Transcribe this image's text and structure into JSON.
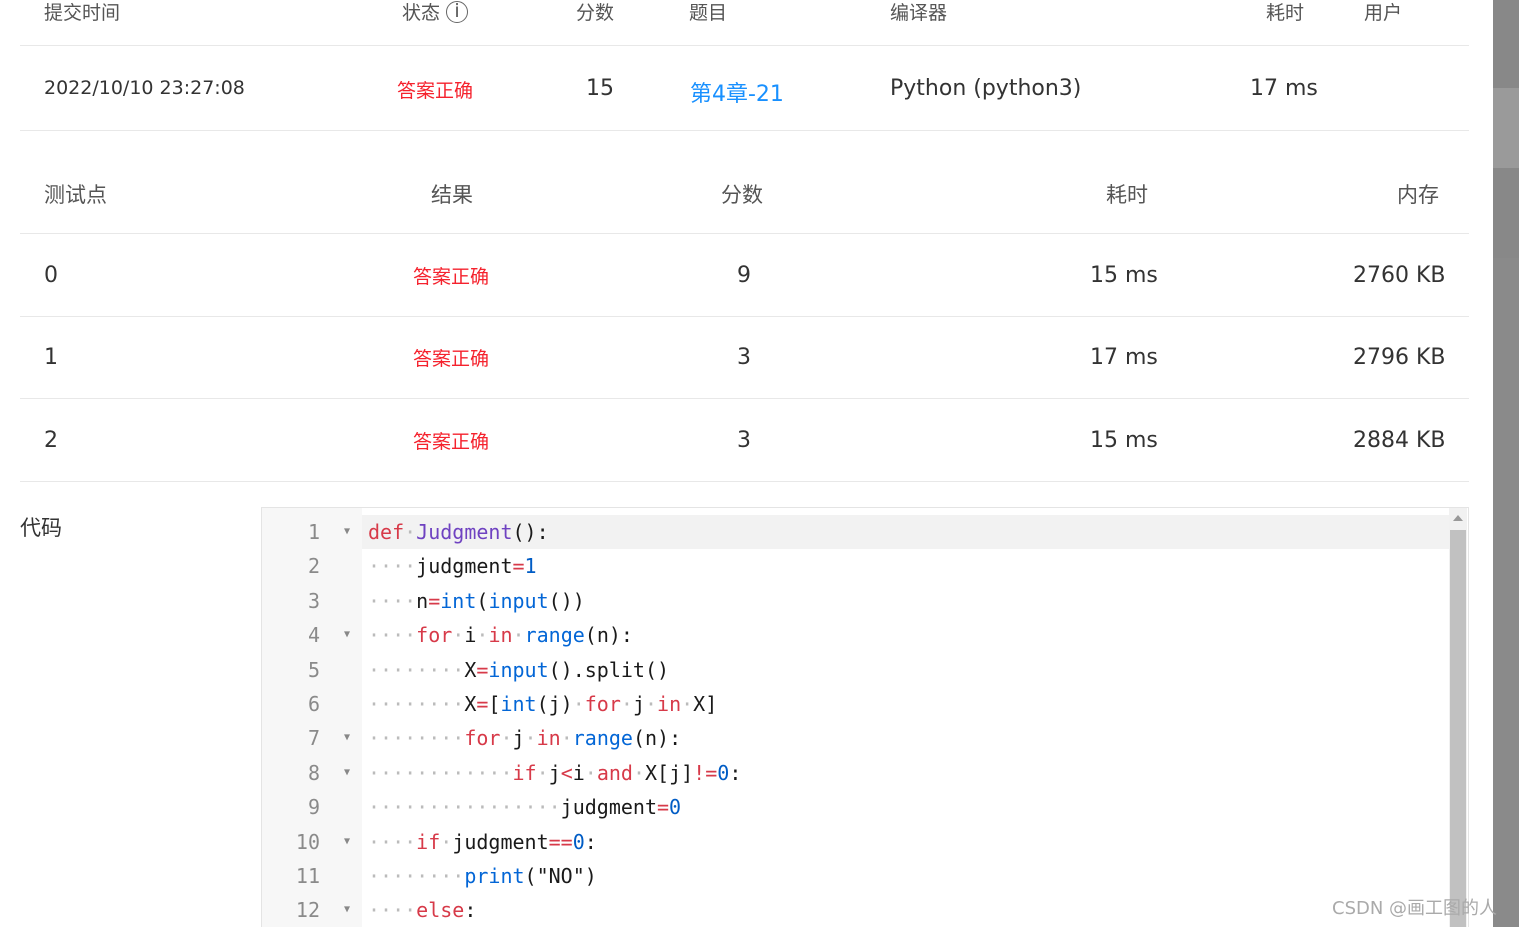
{
  "submission_header": {
    "submit_time": "提交时间",
    "status": "状态",
    "status_info": "i",
    "score": "分数",
    "problem": "题目",
    "compiler": "编译器",
    "time": "耗时",
    "user": "用户"
  },
  "submission": {
    "submit_time": "2022/10/10 23:27:08",
    "status": "答案正确",
    "score": "15",
    "problem": "第4章-21",
    "compiler": "Python (python3)",
    "time": "17 ms",
    "user": ""
  },
  "case_header": {
    "case": "测试点",
    "result": "结果",
    "score": "分数",
    "time": "耗时",
    "memory": "内存"
  },
  "cases": [
    {
      "case": "0",
      "result": "答案正确",
      "score": "9",
      "time": "15 ms",
      "memory": "2760 KB"
    },
    {
      "case": "1",
      "result": "答案正确",
      "score": "3",
      "time": "17 ms",
      "memory": "2796 KB"
    },
    {
      "case": "2",
      "result": "答案正确",
      "score": "3",
      "time": "15 ms",
      "memory": "2884 KB"
    }
  ],
  "code_label": "代码",
  "code_lines": [
    {
      "n": "1",
      "fold": true,
      "text": "def Judgment():"
    },
    {
      "n": "2",
      "fold": false,
      "text": "    judgment=1"
    },
    {
      "n": "3",
      "fold": false,
      "text": "    n=int(input())"
    },
    {
      "n": "4",
      "fold": true,
      "text": "    for i in range(n):"
    },
    {
      "n": "5",
      "fold": false,
      "text": "        X=input().split()"
    },
    {
      "n": "6",
      "fold": false,
      "text": "        X=[int(j) for j in X]"
    },
    {
      "n": "7",
      "fold": true,
      "text": "        for j in range(n):"
    },
    {
      "n": "8",
      "fold": true,
      "text": "            if j<i and X[j]!=0:"
    },
    {
      "n": "9",
      "fold": false,
      "text": "                judgment=0"
    },
    {
      "n": "10",
      "fold": true,
      "text": "    if judgment==0:"
    },
    {
      "n": "11",
      "fold": false,
      "text": "        print(\"NO\")"
    },
    {
      "n": "12",
      "fold": true,
      "text": "    else:"
    }
  ],
  "watermark": "CSDN @画工图的人",
  "colors": {
    "correct": "#f5222d",
    "link": "#1890ff",
    "keyword": "#d73a49",
    "builtin": "#0366d6",
    "function": "#6f42c1"
  }
}
